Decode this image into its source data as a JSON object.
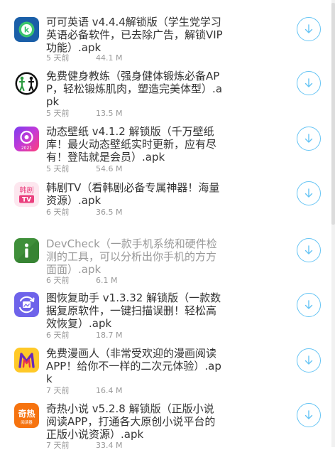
{
  "apps": [
    {
      "title": "可可英语 v4.4.4解锁版（学生党学习英语必备软件，已去除广告，解锁VIP功能）.apk",
      "date": "5 天前",
      "size": "44.1 M",
      "icon": "keke-english-icon",
      "title_color": "#333333"
    },
    {
      "title": "免费健身教练（强身健体锻炼必备APP，轻松锻炼肌肉，塑造完美体型）.apk",
      "date": "5 天前",
      "size": "13.5 M",
      "icon": "fitness-icon",
      "title_color": "#333333"
    },
    {
      "title": "动态壁纸 v4.1.2 解锁版（千万壁纸库！最火动态壁纸实时更新，应有尽有！登陆就是会员）.apk",
      "date": "5 天前",
      "size": "54.6 M",
      "icon": "wallpaper-icon",
      "icon_badge": "2021",
      "title_color": "#333333"
    },
    {
      "title": "韩剧TV（看韩剧必备专属神器！海量资源）.apk",
      "date": "6 天前",
      "size": "36.5 M",
      "icon": "hanju-tv-icon",
      "icon_text_top": "韩剧",
      "icon_text_bottom": "TV",
      "title_color": "#333333"
    },
    {
      "title": "DevCheck（一款手机系统和硬件检测的工具，可以分析出你手机的方方面面）.apk",
      "date": "6 天前",
      "size": "6.1 M",
      "icon": "devcheck-icon",
      "title_color": "#999999"
    },
    {
      "title": "图恢复助手 v1.3.32 解锁版（一款数据复原软件，一键扫描误删！轻松高效恢复）.apk",
      "date": "6 天前",
      "size": "18.7 M",
      "icon": "photo-recovery-icon",
      "title_color": "#333333"
    },
    {
      "title": "免费漫画人（非常受欢迎的漫画阅读APP！给你不一样的二次元体验）.apk",
      "date": "7 天前",
      "size": "16.4 M",
      "icon": "manhua-icon",
      "title_color": "#333333"
    },
    {
      "title": "奇热小说 v5.2.8 解锁版（正版小说阅读APP，打通各大原创小说平台的正版小说资源）.apk",
      "date": "7 天前",
      "size": "33.4 M",
      "icon": "qire-novel-icon",
      "icon_text_top": "奇热",
      "icon_text_bottom": "阅读器",
      "title_color": "#333333"
    }
  ],
  "colors": {
    "download_accent": "#65c4f4",
    "title_text": "#333333",
    "meta_text": "#999999"
  },
  "download_icon": "download-arrow-icon"
}
